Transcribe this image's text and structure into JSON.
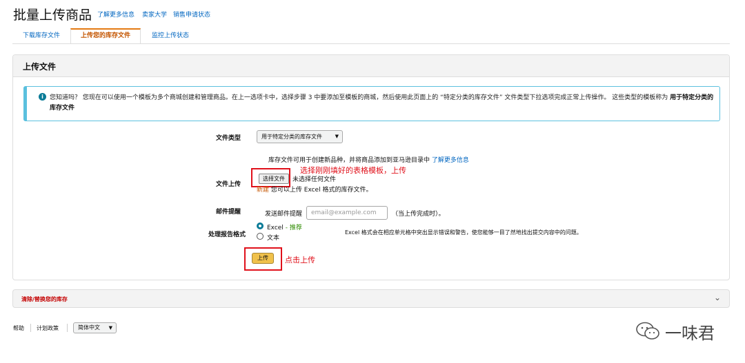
{
  "header": {
    "title": "批量上传商品",
    "links": [
      "了解更多信息",
      "卖家大学",
      "销售申请状态"
    ]
  },
  "tabs": [
    {
      "label": "下载库存文件",
      "active": false
    },
    {
      "label": "上传您的库存文件",
      "active": true
    },
    {
      "label": "监控上传状态",
      "active": false
    }
  ],
  "panel": {
    "title": "上传文件",
    "info": {
      "text": "您知道吗？ 您现在可以使用一个模板为多个商城创建和管理商品。在上一选项卡中，选择步骤 3 中要添加至模板的商城，然后使用此页面上的 “特定分类的库存文件” 文件类型下拉选项完成正常上传操作。 这些类型的模板称为",
      "bold": "用于特定分类的库存文件"
    },
    "file_type": {
      "label": "文件类型",
      "selected": "用于特定分类的库存文件"
    },
    "upload": {
      "label": "文件上传",
      "hint": "库存文件可用于创建新品种，并将商品添加到亚马逊目录中",
      "hint_link": "了解更多信息",
      "choose_button": "选择文件",
      "no_file": "未选择任何文件",
      "new_badge": "新建",
      "excel_note": "您可以上传 Excel 格式的库存文件。"
    },
    "email": {
      "label": "邮件提醒",
      "prefix": "发送邮件提醒",
      "placeholder": "email@example.com",
      "suffix": "（当上传完成时）。"
    },
    "report_format": {
      "label": "处理报告格式",
      "option_excel": "Excel",
      "recommended": "- 推荐",
      "option_text": "文本",
      "note": "Excel 格式会在相应单元格中突出显示错误和警告，使您能够一目了然地找出提交内容中的问题。",
      "selected": "Excel"
    },
    "upload_button": "上传"
  },
  "annotations": {
    "choose_hint": "选择刚刚填好的表格模板，上传",
    "upload_hint": "点击上传",
    "color": "#e0101a"
  },
  "collapsed_section": {
    "label": "清除/替换您的库存"
  },
  "footer": {
    "help": "帮助",
    "plans": "计划政策",
    "language": "简体中文"
  },
  "watermark": {
    "text": "一味君"
  }
}
